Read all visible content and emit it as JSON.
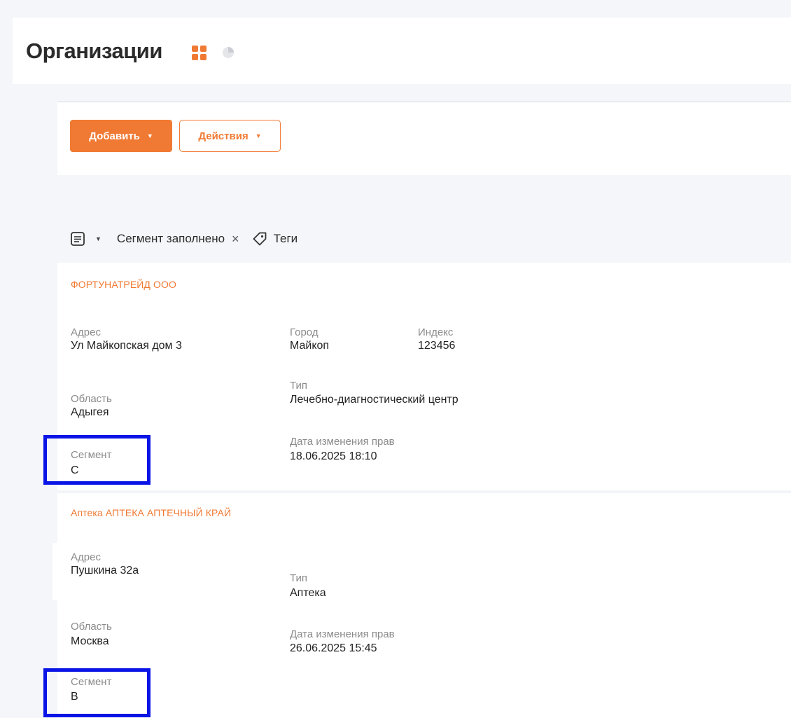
{
  "page": {
    "title": "Организации"
  },
  "toolbar": {
    "add_label": "Добавить",
    "actions_label": "Действия",
    "caret": "▼"
  },
  "filters": {
    "caret": "▼",
    "segment_chip": "Сегмент заполнено",
    "chip_close": "×",
    "tags_label": "Теги"
  },
  "organizations": [
    {
      "name": "ФОРТУНАТРЕЙД ООО",
      "address_label": "Адрес",
      "address": "Ул Майкопская дом 3",
      "city_label": "Город",
      "city": "Майкоп",
      "index_label": "Индекс",
      "index": "123456",
      "region_label": "Область",
      "region": "Адыгея",
      "type_label": "Тип",
      "type": "Лечебно-диагностический центр",
      "segment_label": "Сегмент",
      "segment": "C",
      "rights_date_label": "Дата изменения прав",
      "rights_date": "18.06.2025 18:10"
    },
    {
      "name": "Аптека АПТЕКА АПТЕЧНЫЙ КРАЙ",
      "address_label": "Адрес",
      "address": "Пушкина 32а",
      "type_label": "Тип",
      "type": "Аптека",
      "region_label": "Область",
      "region": "Москва",
      "rights_date_label": "Дата изменения прав",
      "rights_date": "26.06.2025 15:45",
      "segment_label": "Сегмент",
      "segment": "B"
    }
  ],
  "colors": {
    "accent": "#f07a34",
    "highlight": "#0a14e6",
    "background": "#f4f6f9"
  }
}
